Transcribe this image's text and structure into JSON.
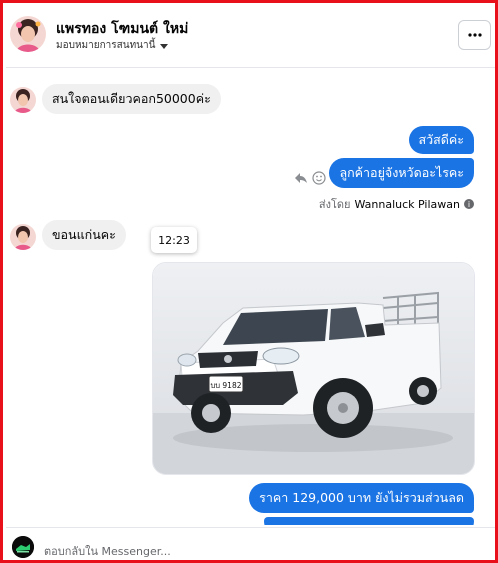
{
  "header": {
    "name": "แพรทอง โฑมนต์ ใหม่",
    "subtitle": "มอบหมายการสนทนานี้"
  },
  "messages": {
    "incoming_1": "สนใจตอนเดียวคอก50000ค่ะ",
    "outgoing_1": "สวัสดีค่ะ",
    "outgoing_2": "ลูกค้าอยู่จังหวัดอะไรคะ",
    "sent_by_prefix": "ส่งโดย",
    "sent_by_name": "Wannaluck Pilawan",
    "incoming_2": "ขอนแก่นคะ",
    "time_tooltip": "12:23",
    "plate_number": "บบ 9182",
    "outgoing_3": "ราคา 129,000 บาท  ยังไม่รวมส่วนลด"
  },
  "composer": {
    "placeholder": "ตอบกลับใน Messenger..."
  },
  "icons": {
    "more": "more-horizontal-icon",
    "dropdown": "caret-down-icon",
    "reply": "reply-icon",
    "react": "smiley-icon",
    "info": "info-icon"
  },
  "colors": {
    "outgoing_bubble": "#1b74e4",
    "incoming_bubble": "#f0f0f0",
    "frame_border": "#e8101a"
  }
}
